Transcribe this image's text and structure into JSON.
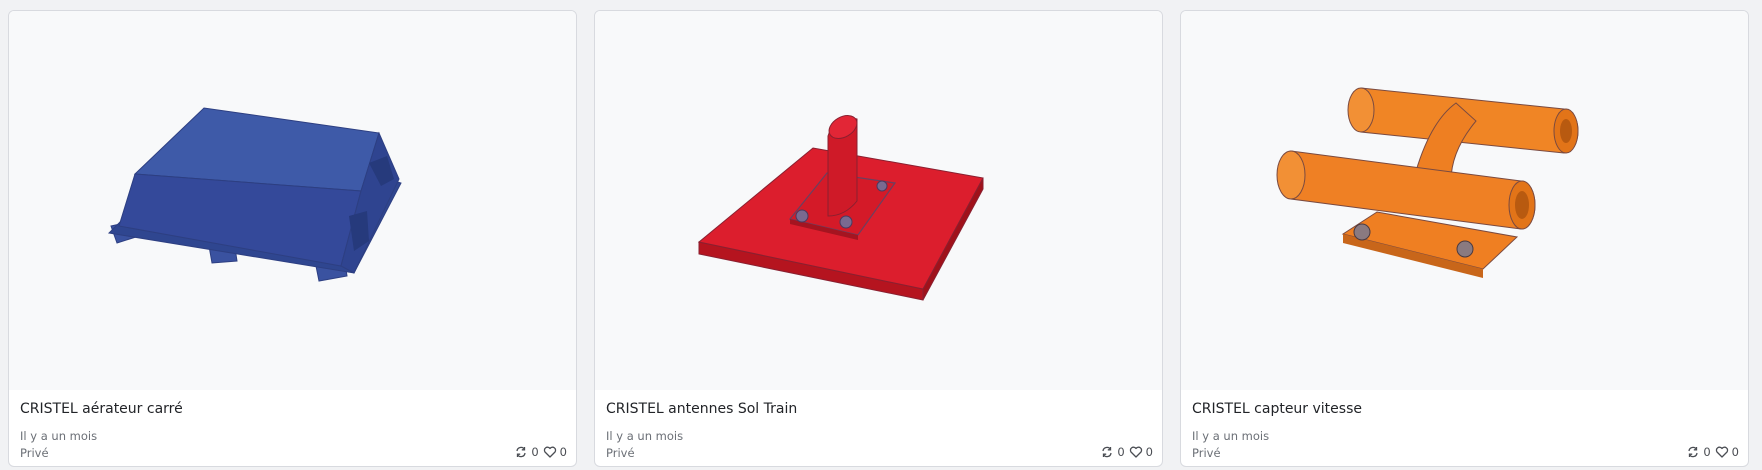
{
  "cards": [
    {
      "title": "CRISTEL aérateur carré",
      "time": "Il y a un mois",
      "privacy": "Privé",
      "remix_count": "0",
      "like_count": "0",
      "model_color": "#3a54a0",
      "thumbnail_icon": "blue-box-model"
    },
    {
      "title": "CRISTEL antennes Sol Train",
      "time": "Il y a un mois",
      "privacy": "Privé",
      "remix_count": "0",
      "like_count": "0",
      "model_color": "#dc1e2d",
      "thumbnail_icon": "red-plate-model"
    },
    {
      "title": "CRISTEL capteur vitesse",
      "time": "Il y a un mois",
      "privacy": "Privé",
      "remix_count": "0",
      "like_count": "0",
      "model_color": "#ef7f22",
      "thumbnail_icon": "orange-sensor-model"
    }
  ]
}
